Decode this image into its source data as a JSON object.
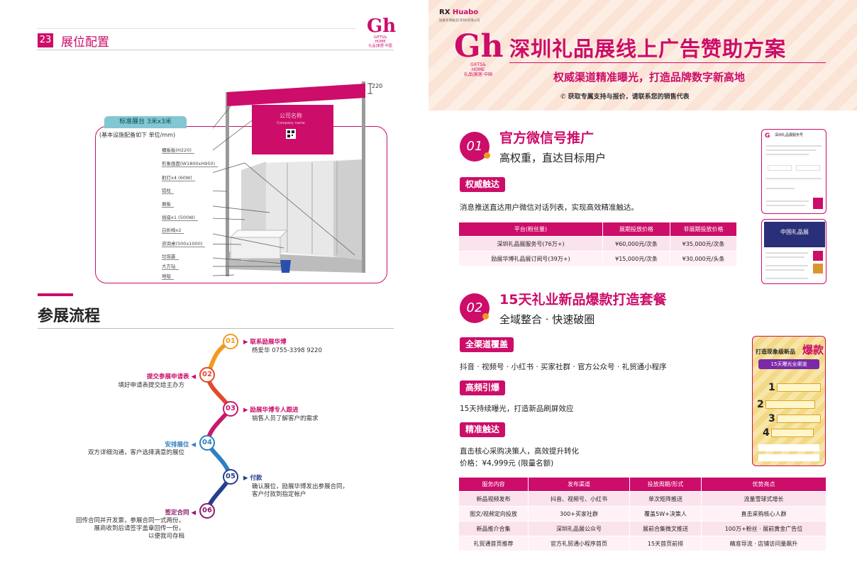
{
  "left": {
    "page_num": "23",
    "page_title": "展位配置",
    "logo": {
      "text": "Gh",
      "sub1": "GIFTS&",
      "sub2": "HOME",
      "sub3": "礼品|家居·中国"
    },
    "booth": {
      "tag": "标准展台 3米x3米",
      "note": "(基本设施配备如下 单位/mm)",
      "dimension": "220",
      "fascia_name": "公司名称",
      "fascia_name_en": "Company name",
      "labels": [
        "楣板板(H220)",
        "形象画面(W1800xH950)",
        "射灯x4 (60W)",
        "铝柱",
        "展板",
        "插座x1 (500W)",
        "白折椅x2",
        "咨询桌(500x1000)",
        "垃圾篓",
        "大方钻",
        "地毯"
      ]
    },
    "process_title": "参展流程",
    "steps": [
      {
        "num": "01",
        "title": "联系励展华博",
        "desc": [
          "杨爱华 0755-3398 9220"
        ],
        "color": "#f29a1e"
      },
      {
        "num": "02",
        "title": "提交参展申请表",
        "desc": [
          "填好申请表提交给主办方"
        ],
        "color": "#e14a2a"
      },
      {
        "num": "03",
        "title": "励展华博专人跟进",
        "desc": [
          "销售人员了解客户的需求"
        ],
        "color": "#c8196b"
      },
      {
        "num": "04",
        "title": "安排展位",
        "desc": [
          "双方详细沟通，客户选择满意的展位"
        ],
        "color": "#2f7fbf"
      },
      {
        "num": "05",
        "title": "付款",
        "desc": [
          "确认展位，励展华博发出参展合同，",
          "客户付款到指定帐户"
        ],
        "color": "#23408e"
      },
      {
        "num": "06",
        "title": "签定合同",
        "desc": [
          "回传合同并开发票，参展合同一式两份，",
          "展商收到后请签字盖章回传一份，",
          "以便我司存档"
        ],
        "color": "#8a1b6b"
      }
    ]
  },
  "right": {
    "brand": {
      "rx": "RX",
      "huabo": "Huabo",
      "sub": "励展华博展览(深圳)有限公司"
    },
    "banner_logo": {
      "text": "Gh",
      "sub1": "GIFTS&",
      "sub2": "HOME",
      "sub3": "礼品|家居·中国"
    },
    "banner_title": "深圳礼品展线上广告赞助方案",
    "banner_sub": "权威渠道精准曝光，打造品牌数字新高地",
    "banner_contact": "✆ 获取专属支持与报价，请联系您的销售代表",
    "s1": {
      "num": "01",
      "title": "官方微信号推广",
      "subtitle": "高权重，直达目标用户",
      "pill": "权威触达",
      "para": "消息推送直达用户微信对话列表，实现高效精准触达。",
      "table": {
        "headers": [
          "平台(粉丝量)",
          "展期投放价格",
          "非展期投放价格"
        ],
        "rows": [
          [
            "深圳礼品展服务号(76万+)",
            "¥60,000元/次条",
            "¥35,000元/次条"
          ],
          [
            "励展华博礼品展订阅号(39万+)",
            "¥15,000元/次条",
            "¥30,000元/头条"
          ]
        ]
      },
      "phone1_title": "深圳礼品展服务号",
      "phone2_title": "中国礼品展"
    },
    "s2": {
      "num": "02",
      "title": "15天礼业新品爆款打造套餐",
      "subtitle": "全域整合 · 快速破圈",
      "pill1": "全渠道覆盖",
      "para1": "抖音 · 视频号 · 小红书 · 买家社群 · 官方公众号 · 礼贸通小程序",
      "pill2": "高频引爆",
      "para2": "15天持续曝光，打造新品刷屏效应",
      "pill3": "精准触达",
      "para3": "直击核心采购决策人，高效提升转化",
      "price": "价格：¥4,999元 (限量名额)",
      "poster": {
        "t1": "打造现象级新品",
        "t2": "爆款",
        "t3": "15天曝光全渠道",
        "items": [
          "1",
          "2",
          "3",
          "4"
        ]
      },
      "table": {
        "headers": [
          "服务内容",
          "发布渠道",
          "投放周期/形式",
          "优势亮点"
        ],
        "rows": [
          [
            "新品视频发布",
            "抖音、视频号、小红书",
            "单次矩阵推送",
            "流量雪球式增长"
          ],
          [
            "图文/视频定向投放",
            "300+买家社群",
            "覆盖5W+决策人",
            "直击采购核心人群"
          ],
          [
            "新品推介合集",
            "深圳礼品展公众号",
            "展前合集微文推送",
            "100万+粉丝 · 展前黄金广告位"
          ],
          [
            "礼贸通首页推荐",
            "官方礼贸通小程序首页",
            "15天首页前排",
            "精准导流 · 店铺访问量飙升"
          ]
        ]
      }
    }
  }
}
